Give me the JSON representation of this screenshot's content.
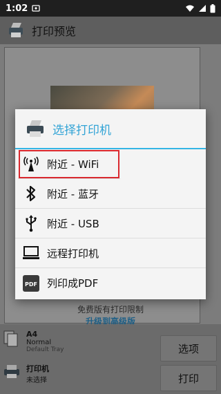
{
  "statusbar": {
    "time": "1:02"
  },
  "appbar": {
    "title": "打印预览"
  },
  "preview": {
    "limit_text": "免费版有打印限制",
    "upgrade_text": "升级到高级版"
  },
  "bottom": {
    "paper": {
      "size": "A4",
      "type": "Normal",
      "tray": "Default Tray"
    },
    "printer": {
      "label": "打印机",
      "status": "未选择"
    },
    "options_button": "选项",
    "print_button": "打印"
  },
  "dialog": {
    "title": "选择打印机",
    "options": [
      {
        "label": "附近 - WiFi",
        "icon": "wifi-antenna-icon"
      },
      {
        "label": "附近 - 蓝牙",
        "icon": "bluetooth-icon"
      },
      {
        "label": "附近 - USB",
        "icon": "usb-icon"
      },
      {
        "label": "远程打印机",
        "icon": "computer-icon"
      },
      {
        "label": "列印成PDF",
        "icon": "pdf-icon"
      }
    ]
  },
  "colors": {
    "accent": "#33b5e5",
    "highlight": "#d9282e"
  }
}
